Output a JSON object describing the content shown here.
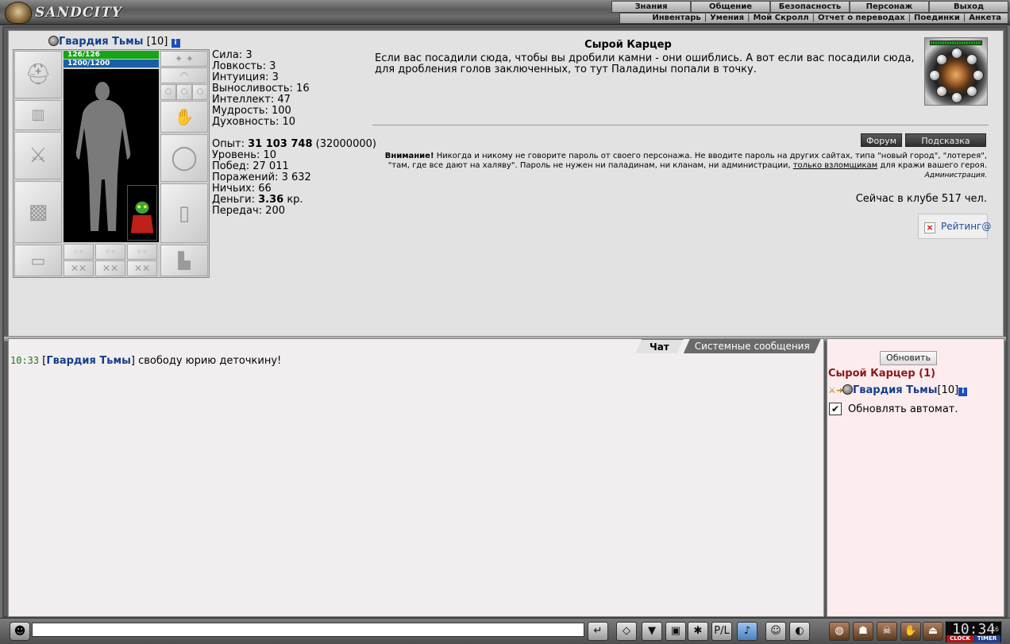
{
  "app": {
    "logo_text": "SANDCITY"
  },
  "top_menu": [
    "Знания",
    "Общение",
    "Безопасность",
    "Персонаж",
    "Выход"
  ],
  "sub_menu": [
    "Инвентарь",
    "Умения",
    "Мой Скролл",
    "Отчет о переводах",
    "Поединки",
    "Анкета"
  ],
  "character": {
    "name": "Гвардия Тьмы",
    "level_tag": "[10]",
    "hp": "126/126",
    "mp": "1200/1200",
    "stats": [
      "Сила: 3",
      "Ловкость: 3",
      "Интуиция: 3",
      "Выносливость: 16",
      "Интеллект: 47",
      "Мудрость: 100",
      "Духовность: 10"
    ],
    "exp_label": "Опыт: ",
    "exp_value": "31 103 748",
    "exp_next": " (32000000)",
    "level": "Уровень: 10",
    "wins": "Побед: 27 011",
    "losses": "Поражений: 3 632",
    "draws": "Ничьих: 66",
    "money_label": "Деньги: ",
    "money_value": "3.36",
    "money_unit": " кр.",
    "transfers": "Передач: 200"
  },
  "location": {
    "title": "Сырой Карцер",
    "description": "Если вас посадили сюда, чтобы вы дробили камни - они ошиблись. А вот если вас посадили сюда, для дробления голов заключенных, то тут Паладины попали в точку."
  },
  "buttons": {
    "forum": "Форум",
    "hint": "Подсказка",
    "refresh": "Обновить"
  },
  "warning": {
    "bold": "Внимание!",
    "text1": " Никогда и никому не говорите пароль от своего персонажа. Не вводите пароль на других сайтах, типа \"новый город\", \"лотерея\", \"там, где все дают на халяву\". Пароль не нужен ни паладинам, ни кланам, ни администрации, ",
    "link": "только взломщикам",
    "text2": " для кражи вашего героя.",
    "signature": "Администрация."
  },
  "online_text": "Сейчас в клубе 517 чел.",
  "rating_label": "Рейтинг@",
  "chat": {
    "tabs": [
      "Чат",
      "Системные сообщения"
    ],
    "messages": [
      {
        "time": "10:33",
        "author": "Гвардия Тьмы",
        "text": " свободу юрию деточкину!"
      }
    ]
  },
  "room": {
    "title": "Сырой Карцер (1)",
    "people": [
      {
        "name": "Гвардия Тьмы",
        "level": "[10]"
      }
    ],
    "auto_refresh_label": "Обновлять автомат.",
    "auto_refresh_checked": true
  },
  "chat_input": {
    "value": ""
  },
  "clock": {
    "time": "10:34",
    "seconds": "16",
    "label_clock": "CLOCK",
    "label_timer": "TIMER"
  },
  "icons": {
    "toolbar": [
      "send-icon",
      "eraser-icon",
      "filter-icon",
      "save-icon",
      "dance-icon",
      "translit-icon",
      "music-icon",
      "smile-icon",
      "sound-icon"
    ],
    "tray": [
      "bag-icon",
      "helmet-icon",
      "orc-icon",
      "hand-icon",
      "exit-icon"
    ]
  },
  "colors": {
    "name_link": "#153e8a",
    "room_title": "#8a1a1a",
    "hp": "#17a417",
    "mp": "#1a5fa6"
  }
}
